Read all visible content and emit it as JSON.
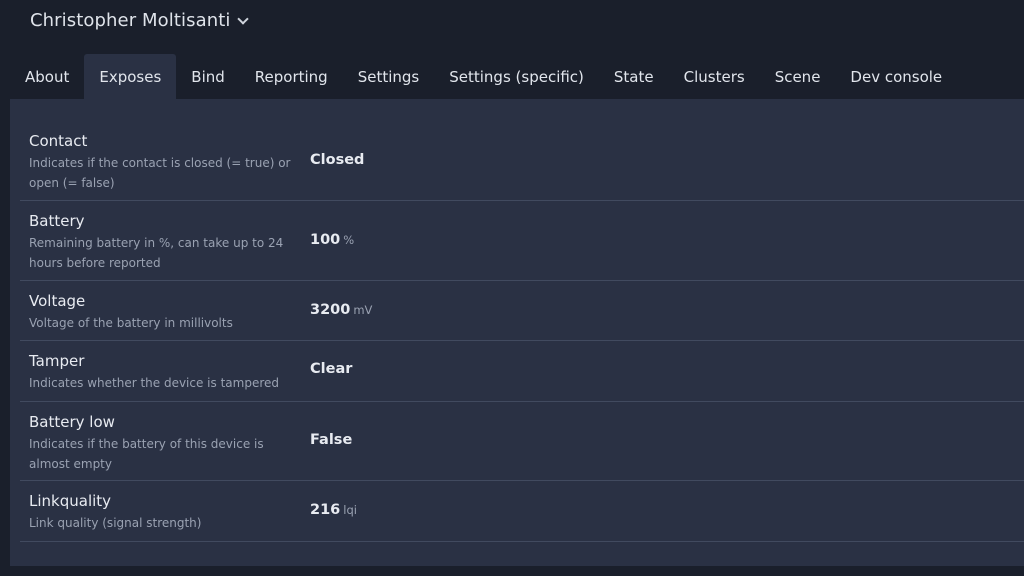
{
  "header": {
    "device_name": "Christopher Moltisanti"
  },
  "tabs": [
    {
      "label": "About",
      "active": false
    },
    {
      "label": "Exposes",
      "active": true
    },
    {
      "label": "Bind",
      "active": false
    },
    {
      "label": "Reporting",
      "active": false
    },
    {
      "label": "Settings",
      "active": false
    },
    {
      "label": "Settings (specific)",
      "active": false
    },
    {
      "label": "State",
      "active": false
    },
    {
      "label": "Clusters",
      "active": false
    },
    {
      "label": "Scene",
      "active": false
    },
    {
      "label": "Dev console",
      "active": false
    }
  ],
  "exposes": [
    {
      "name": "Contact",
      "description": "Indicates if the contact is closed (= true) or open (= false)",
      "value": "Closed",
      "unit": ""
    },
    {
      "name": "Battery",
      "description": "Remaining battery in %, can take up to 24 hours before reported",
      "value": "100",
      "unit": "%"
    },
    {
      "name": "Voltage",
      "description": "Voltage of the battery in millivolts",
      "value": "3200",
      "unit": "mV"
    },
    {
      "name": "Tamper",
      "description": "Indicates whether the device is tampered",
      "value": "Clear",
      "unit": ""
    },
    {
      "name": "Battery low",
      "description": "Indicates if the battery of this device is almost empty",
      "value": "False",
      "unit": ""
    },
    {
      "name": "Linkquality",
      "description": "Link quality (signal strength)",
      "value": "216",
      "unit": "lqi"
    }
  ]
}
